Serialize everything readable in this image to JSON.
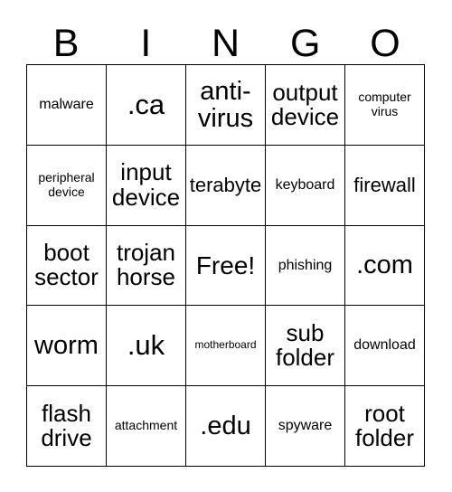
{
  "card": {
    "title": "Bingo Card",
    "background_color": "#ffffff",
    "border_color": "#000000",
    "text_color": "#000000"
  },
  "header": {
    "letters": [
      {
        "label": "B"
      },
      {
        "label": "I"
      },
      {
        "label": "N"
      },
      {
        "label": "G"
      },
      {
        "label": "O"
      }
    ]
  },
  "grid": {
    "columns": 5,
    "rows": 5,
    "free_space_label": "Free!",
    "cells": [
      [
        {
          "label": "malware",
          "size": "sm"
        },
        {
          "label": ".ca",
          "size": "xxl"
        },
        {
          "label": "anti-virus",
          "size": "xl"
        },
        {
          "label": "output device",
          "size": "lg"
        },
        {
          "label": "computer virus",
          "size": "xs"
        }
      ],
      [
        {
          "label": "peripheral device",
          "size": "xs"
        },
        {
          "label": "input device",
          "size": "lg"
        },
        {
          "label": "terabyte",
          "size": "md"
        },
        {
          "label": "keyboard",
          "size": "sm"
        },
        {
          "label": "firewall",
          "size": "md"
        }
      ],
      [
        {
          "label": "boot sector",
          "size": "lg"
        },
        {
          "label": "trojan horse",
          "size": "lg"
        },
        {
          "label": "Free!",
          "size": "free"
        },
        {
          "label": "phishing",
          "size": "sm"
        },
        {
          "label": ".com",
          "size": "xl"
        }
      ],
      [
        {
          "label": "worm",
          "size": "xl"
        },
        {
          "label": ".uk",
          "size": "xxl"
        },
        {
          "label": "motherboard",
          "size": "xxs"
        },
        {
          "label": "sub folder",
          "size": "lg"
        },
        {
          "label": "download",
          "size": "sm"
        }
      ],
      [
        {
          "label": "flash drive",
          "size": "lg"
        },
        {
          "label": "attachment",
          "size": "xs"
        },
        {
          "label": ".edu",
          "size": "xl"
        },
        {
          "label": "spyware",
          "size": "sm"
        },
        {
          "label": "root folder",
          "size": "lg"
        }
      ]
    ]
  }
}
